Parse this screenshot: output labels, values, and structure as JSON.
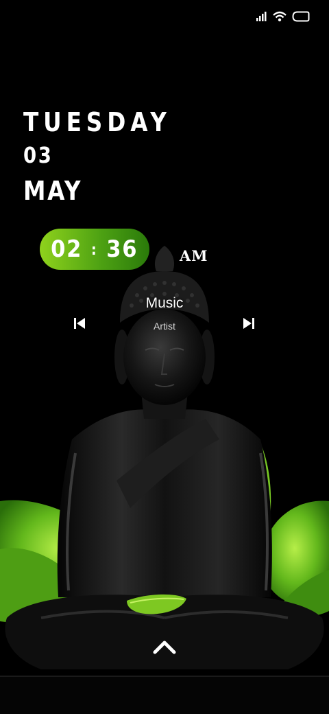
{
  "status_bar": {
    "icons": [
      "signal-icon",
      "wifi-icon",
      "battery-icon"
    ]
  },
  "date": {
    "day": "TUESDAY",
    "date_number": "03",
    "month": "MAY"
  },
  "clock": {
    "hours": "02",
    "separator": ":",
    "minutes": "36",
    "ampm": "AM"
  },
  "music": {
    "title": "Music",
    "artist": "Artist"
  },
  "controls": {
    "previous": "skip-previous-icon",
    "next": "skip-next-icon",
    "swipe": "chevron-up-icon"
  },
  "colors": {
    "background": "#000000",
    "accent_green": "#6ab81a",
    "text": "#ffffff"
  }
}
